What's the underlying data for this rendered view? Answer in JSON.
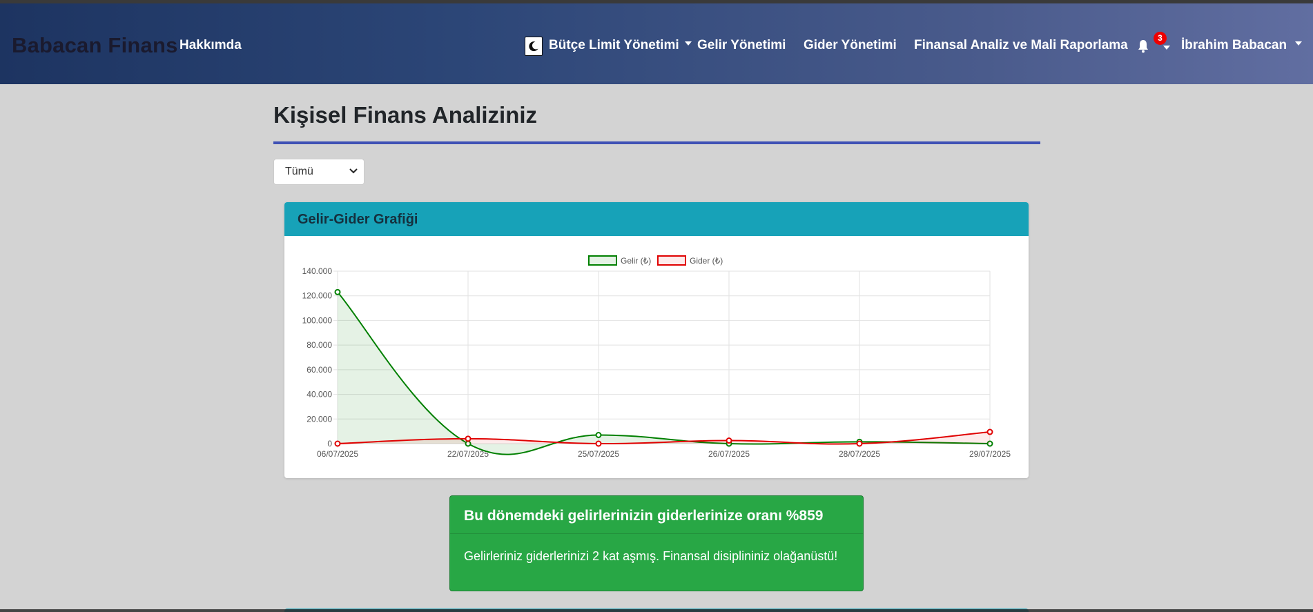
{
  "navbar": {
    "brand": "Babacan Finans",
    "about": "Hakkımda",
    "budget_menu": "Bütçe Limit Yönetimi",
    "income": "Gelir Yönetimi",
    "expense": "Gider Yönetimi",
    "analysis": "Finansal Analiz ve Mali Raporlama",
    "notification_count": "3",
    "user": "İbrahim Babacan"
  },
  "main": {
    "title": "Kişisel Finans Analiziniz",
    "period_select": "Tümü"
  },
  "chart_card": {
    "header": "Gelir-Gider Grafiği"
  },
  "chart_data": {
    "type": "line",
    "categories": [
      "06/07/2025",
      "22/07/2025",
      "25/07/2025",
      "26/07/2025",
      "28/07/2025",
      "29/07/2025"
    ],
    "series": [
      {
        "name": "Gelir (₺)",
        "color": "#008000",
        "values": [
          123000,
          0,
          7000,
          0,
          1500,
          0
        ]
      },
      {
        "name": "Gider (₺)",
        "color": "#e00000",
        "values": [
          0,
          4000,
          0,
          2500,
          0,
          9500
        ]
      }
    ],
    "ylim": [
      0,
      140000
    ],
    "yticks": [
      "0",
      "20.000",
      "40.000",
      "60.000",
      "80.000",
      "100.000",
      "120.000",
      "140.000"
    ],
    "grid": true,
    "legend": "top-center"
  },
  "ratio_alert": {
    "heading": "Bu dönemdeki gelirlerinizin giderlerinize oranı %859",
    "message": "Gelirleriniz giderlerinizi 2 kat aşmış. Finansal disiplininiz olağanüstü!"
  }
}
